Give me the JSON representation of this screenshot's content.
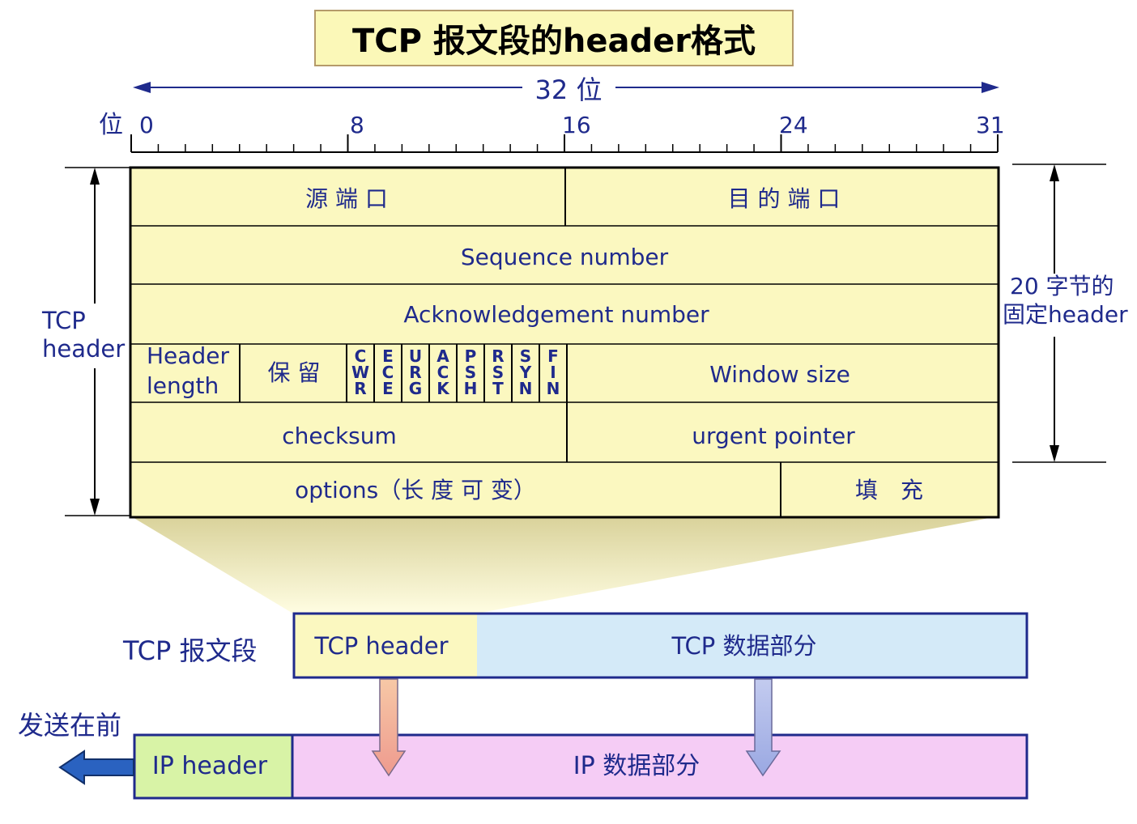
{
  "title": "TCP 报文段的header格式",
  "ruler": {
    "span_label": "32 位",
    "bit_label": "位",
    "ticks": [
      "0",
      "8",
      "16",
      "24",
      "31"
    ]
  },
  "header": {
    "src_port": "源 端 口",
    "dst_port": "目 的 端 口",
    "sequence": "Sequence number",
    "ack": "Acknowledgement number",
    "header_length": [
      "Header",
      "length"
    ],
    "reserved": "保 留",
    "flags": [
      "CWR",
      "ECE",
      "URG",
      "ACK",
      "PSH",
      "RST",
      "SYN",
      "FIN"
    ],
    "window": "Window size",
    "checksum": "checksum",
    "urgent": "urgent pointer",
    "options": "options（长 度 可 变）",
    "padding": "填　充"
  },
  "left_label": [
    "TCP",
    "header"
  ],
  "right_label": [
    "20 字节的",
    "固定header"
  ],
  "segment": {
    "label": "TCP 报文段",
    "header": "TCP header",
    "data": "TCP 数据部分"
  },
  "ip": {
    "send_first": "发送在前",
    "header": "IP header",
    "data": "IP 数据部分"
  },
  "colors": {
    "text": "#1f2a8c",
    "header_fill": "#fbf8c0",
    "tcp_data_fill": "#d4eaf8",
    "ip_header_fill": "#d8f3a6",
    "ip_data_fill": "#f5ccf5",
    "send_arrow": "#2a62c0"
  }
}
